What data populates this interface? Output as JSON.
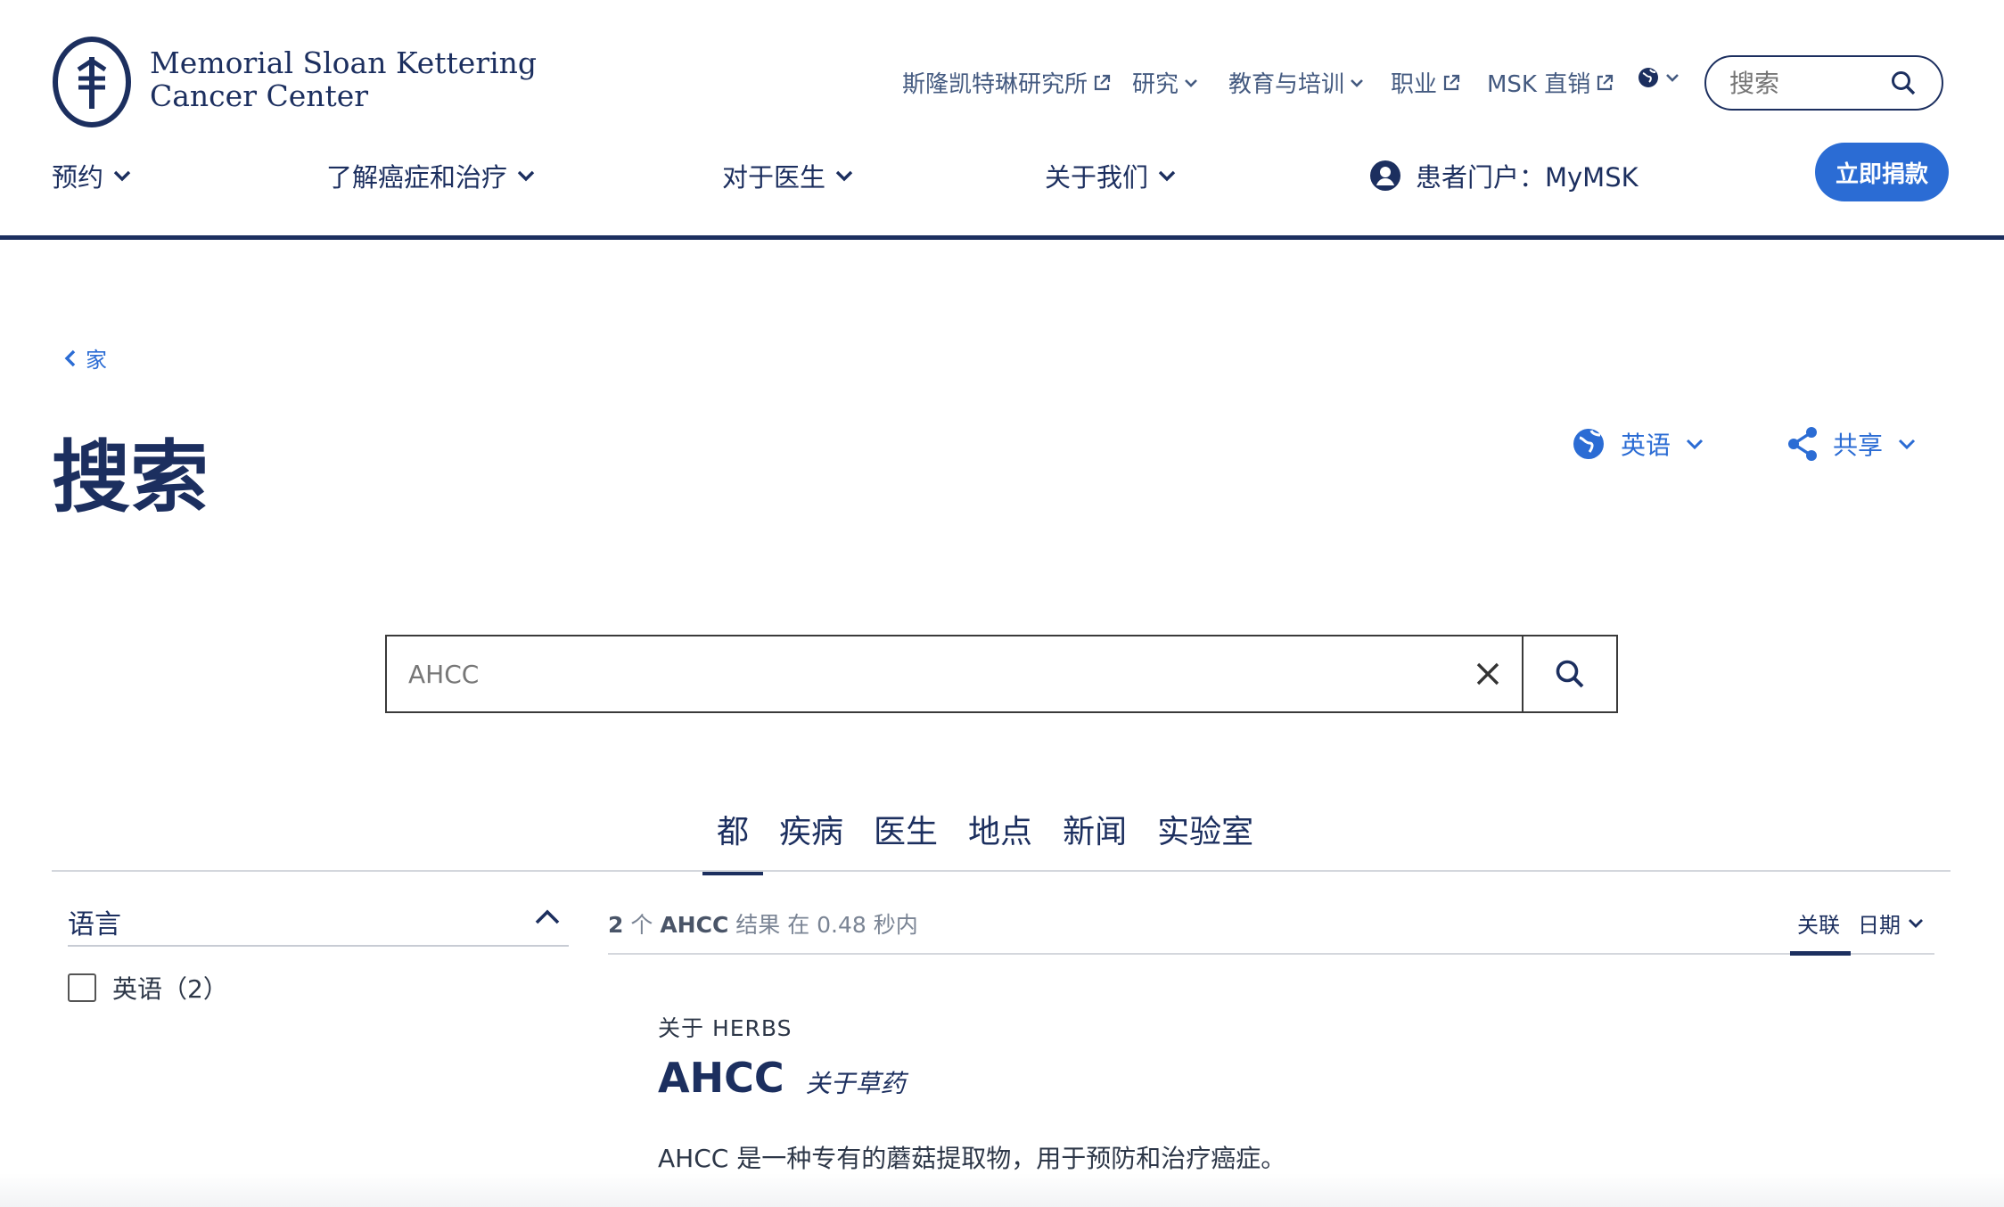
{
  "colors": {
    "navy": "#1c2f5f",
    "accent": "#2b6cd4"
  },
  "header": {
    "logo_line1": "Memorial Sloan Kettering",
    "logo_line2": "Cancer Center",
    "utility_nav": [
      {
        "label": "斯隆凯特琳研究所",
        "icon": "external-link-icon"
      },
      {
        "label": "研究",
        "icon": "chevron-down-icon"
      },
      {
        "label": "教育与培训",
        "icon": "chevron-down-icon"
      },
      {
        "label": "职业",
        "icon": "external-link-icon"
      },
      {
        "label": "MSK 直销",
        "icon": "external-link-icon"
      }
    ],
    "language_icon": "globe-icon",
    "search_placeholder": "搜索",
    "main_nav": [
      {
        "label": "预约"
      },
      {
        "label": "了解癌症和治疗"
      },
      {
        "label": "对于医生"
      },
      {
        "label": "关于我们"
      }
    ],
    "patient_portal": "患者门户：MyMSK",
    "donate": "立即捐款"
  },
  "breadcrumb": "家",
  "page_title": "搜索",
  "language_selector": "英语",
  "share": "共享",
  "search": {
    "value": "AHCC"
  },
  "tabs": [
    "都",
    "疾病",
    "医生",
    "地点",
    "新闻",
    "实验室"
  ],
  "active_tab": "都",
  "facet": {
    "title": "语言",
    "option": "英语（2）"
  },
  "results": {
    "count": "2",
    "count_suffix": "个",
    "query": "AHCC",
    "summary_mid": "结果 在",
    "time": "0.48",
    "summary_end": "秒内",
    "sort_relevance": "关联",
    "sort_date": "日期",
    "items": [
      {
        "kicker": "关于 HERBS",
        "title": "AHCC",
        "subtitle": "关于草药",
        "description": "AHCC 是一种专有的蘑菇提取物，用于预防和治疗癌症。"
      }
    ]
  }
}
